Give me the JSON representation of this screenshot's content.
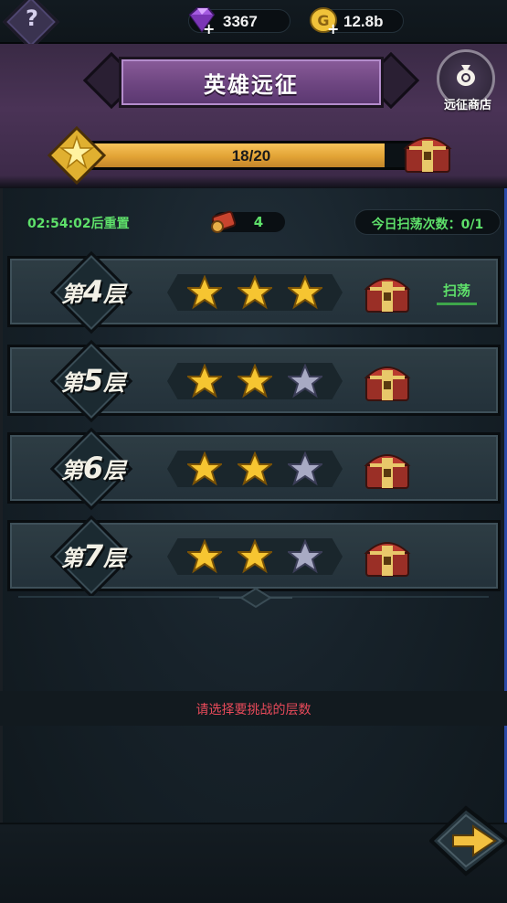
{
  "resources": {
    "gems": "3367",
    "gold": "12.8b",
    "gem_color": "#a45be0",
    "gold_color": "#f0c23a"
  },
  "header": {
    "title": "英雄远征",
    "shop_label": "远征商店",
    "progress_text": "18/20",
    "progress_fraction": 0.9
  },
  "info": {
    "reset_text": "02:54:02后重置",
    "ticket_count": "4",
    "sweep_count_text": "今日扫荡次数：0/1"
  },
  "floors": [
    {
      "prefix": "第",
      "number": "4",
      "suffix": "层",
      "stars": 3,
      "max_stars": 3,
      "sweep_label": "扫荡"
    },
    {
      "prefix": "第",
      "number": "5",
      "suffix": "层",
      "stars": 2,
      "max_stars": 3
    },
    {
      "prefix": "第",
      "number": "6",
      "suffix": "层",
      "stars": 2,
      "max_stars": 3
    },
    {
      "prefix": "第",
      "number": "7",
      "suffix": "层",
      "stars": 2,
      "max_stars": 3
    }
  ],
  "hint": "请选择要挑战的层数",
  "colors": {
    "accent_green": "#5ee06a",
    "hint_red": "#e84a5a",
    "star_gold": "#f6c531",
    "star_silver": "#a8aac4",
    "progress_orange": "#e2a335",
    "header_purple": "#4a3356"
  },
  "icons": {
    "help": "help-icon",
    "gem": "gem-icon",
    "gold": "gold-coin-icon",
    "shop": "money-bag-icon",
    "progress_star": "star-emblem-icon",
    "chest": "treasure-chest-icon",
    "ticket": "scroll-ticket-icon",
    "next": "arrow-right-icon"
  }
}
